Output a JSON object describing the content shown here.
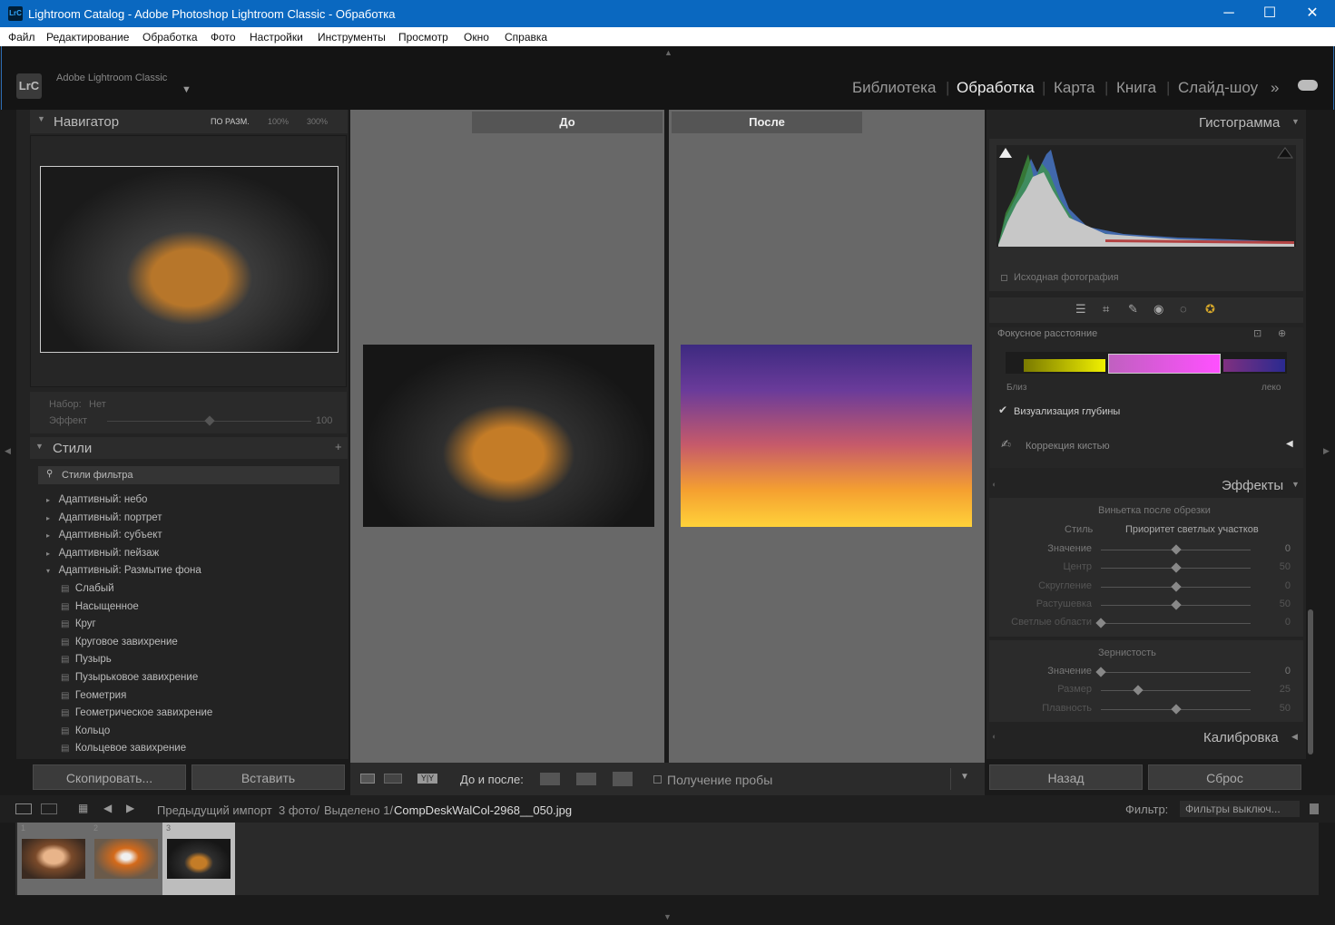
{
  "window": {
    "title": "Lightroom Catalog - Adobe Photoshop Lightroom Classic - Обработка",
    "icon_text": "LrC",
    "minimize": "─",
    "maximize": "☐",
    "close": "✕"
  },
  "menu": [
    "Файл",
    "Редактирование",
    "Обработка",
    "Фото",
    "Настройки",
    "Инструменты",
    "Просмотр",
    "Окно",
    "Справка"
  ],
  "header": {
    "logo": "LrC",
    "app_name": "Adobe Lightroom Classic",
    "modules": [
      "Библиотека",
      "Обработка",
      "Карта",
      "Книга",
      "Слайд-шоу"
    ],
    "active_module": "Обработка"
  },
  "navigator": {
    "title": "Навигатор",
    "zoom": [
      "ПО РАЗМ.",
      "100%",
      "300%"
    ]
  },
  "preset_amount": {
    "set_label": "Набор:",
    "set_value": "Нет",
    "effect_label": "Эффект",
    "effect_value": "100",
    "effect_level": 0.5
  },
  "styles": {
    "title": "Стили",
    "filter_placeholder": "Стили фильтра",
    "groups": [
      "Адаптивный: небо",
      "Адаптивный: портрет",
      "Адаптивный: субъект",
      "Адаптивный: пейзаж",
      "Адаптивный: Размытие фона"
    ],
    "items": [
      "Слабый",
      "Насыщенное",
      "Круг",
      "Круговое завихрение",
      "Пузырь",
      "Пузырьковое завихрение",
      "Геометрия",
      "Геометрическое завихрение",
      "Кольцо",
      "Кольцевое завихрение"
    ]
  },
  "left_buttons": {
    "copy": "Скопировать...",
    "paste": "Вставить"
  },
  "view": {
    "before": "До",
    "after": "После"
  },
  "histogram": {
    "title": "Гистограмма",
    "original": "Исходная фотография"
  },
  "depth": {
    "title": "Фокусное расстояние",
    "near": "Близ",
    "far": "лeко",
    "visualize": "Визуализация глубины",
    "brush": "Коррекция кистью"
  },
  "effects": {
    "title": "Эффекты",
    "vignette_title": "Виньетка после обрезки",
    "style_label": "Стиль",
    "style_value": "Приоритет светлых участков",
    "vignette": [
      {
        "label": "Значение",
        "value": "0",
        "level": 0.5
      },
      {
        "label": "Центр",
        "value": "50",
        "level": 0.5
      },
      {
        "label": "Скругление",
        "value": "0",
        "level": 0.5
      },
      {
        "label": "Растушевка",
        "value": "50",
        "level": 0.5
      },
      {
        "label": "Светлые области",
        "value": "0",
        "level": 0.0
      }
    ],
    "grain_title": "Зернистость",
    "grain": [
      {
        "label": "Значение",
        "value": "0",
        "level": 0.0
      },
      {
        "label": "Размер",
        "value": "25",
        "level": 0.25
      },
      {
        "label": "Плавность",
        "value": "50",
        "level": 0.5
      }
    ]
  },
  "calibration": {
    "title": "Калибровка"
  },
  "right_buttons": {
    "back": "Назад",
    "reset": "Сброс"
  },
  "toolbar": {
    "before_after": "До и после:",
    "soft_proof": "Получение пробы"
  },
  "filmbar": {
    "source": "Предыдущий импорт",
    "count": "3 фото/",
    "selected": "Выделено 1/",
    "filename": "CompDeskWalCol-2968__050.jpg",
    "filter_label": "Фильтр:",
    "filter_value": "Фильтры выключ..."
  },
  "filmstrip": {
    "numbers": [
      "1",
      "2",
      "3"
    ]
  }
}
